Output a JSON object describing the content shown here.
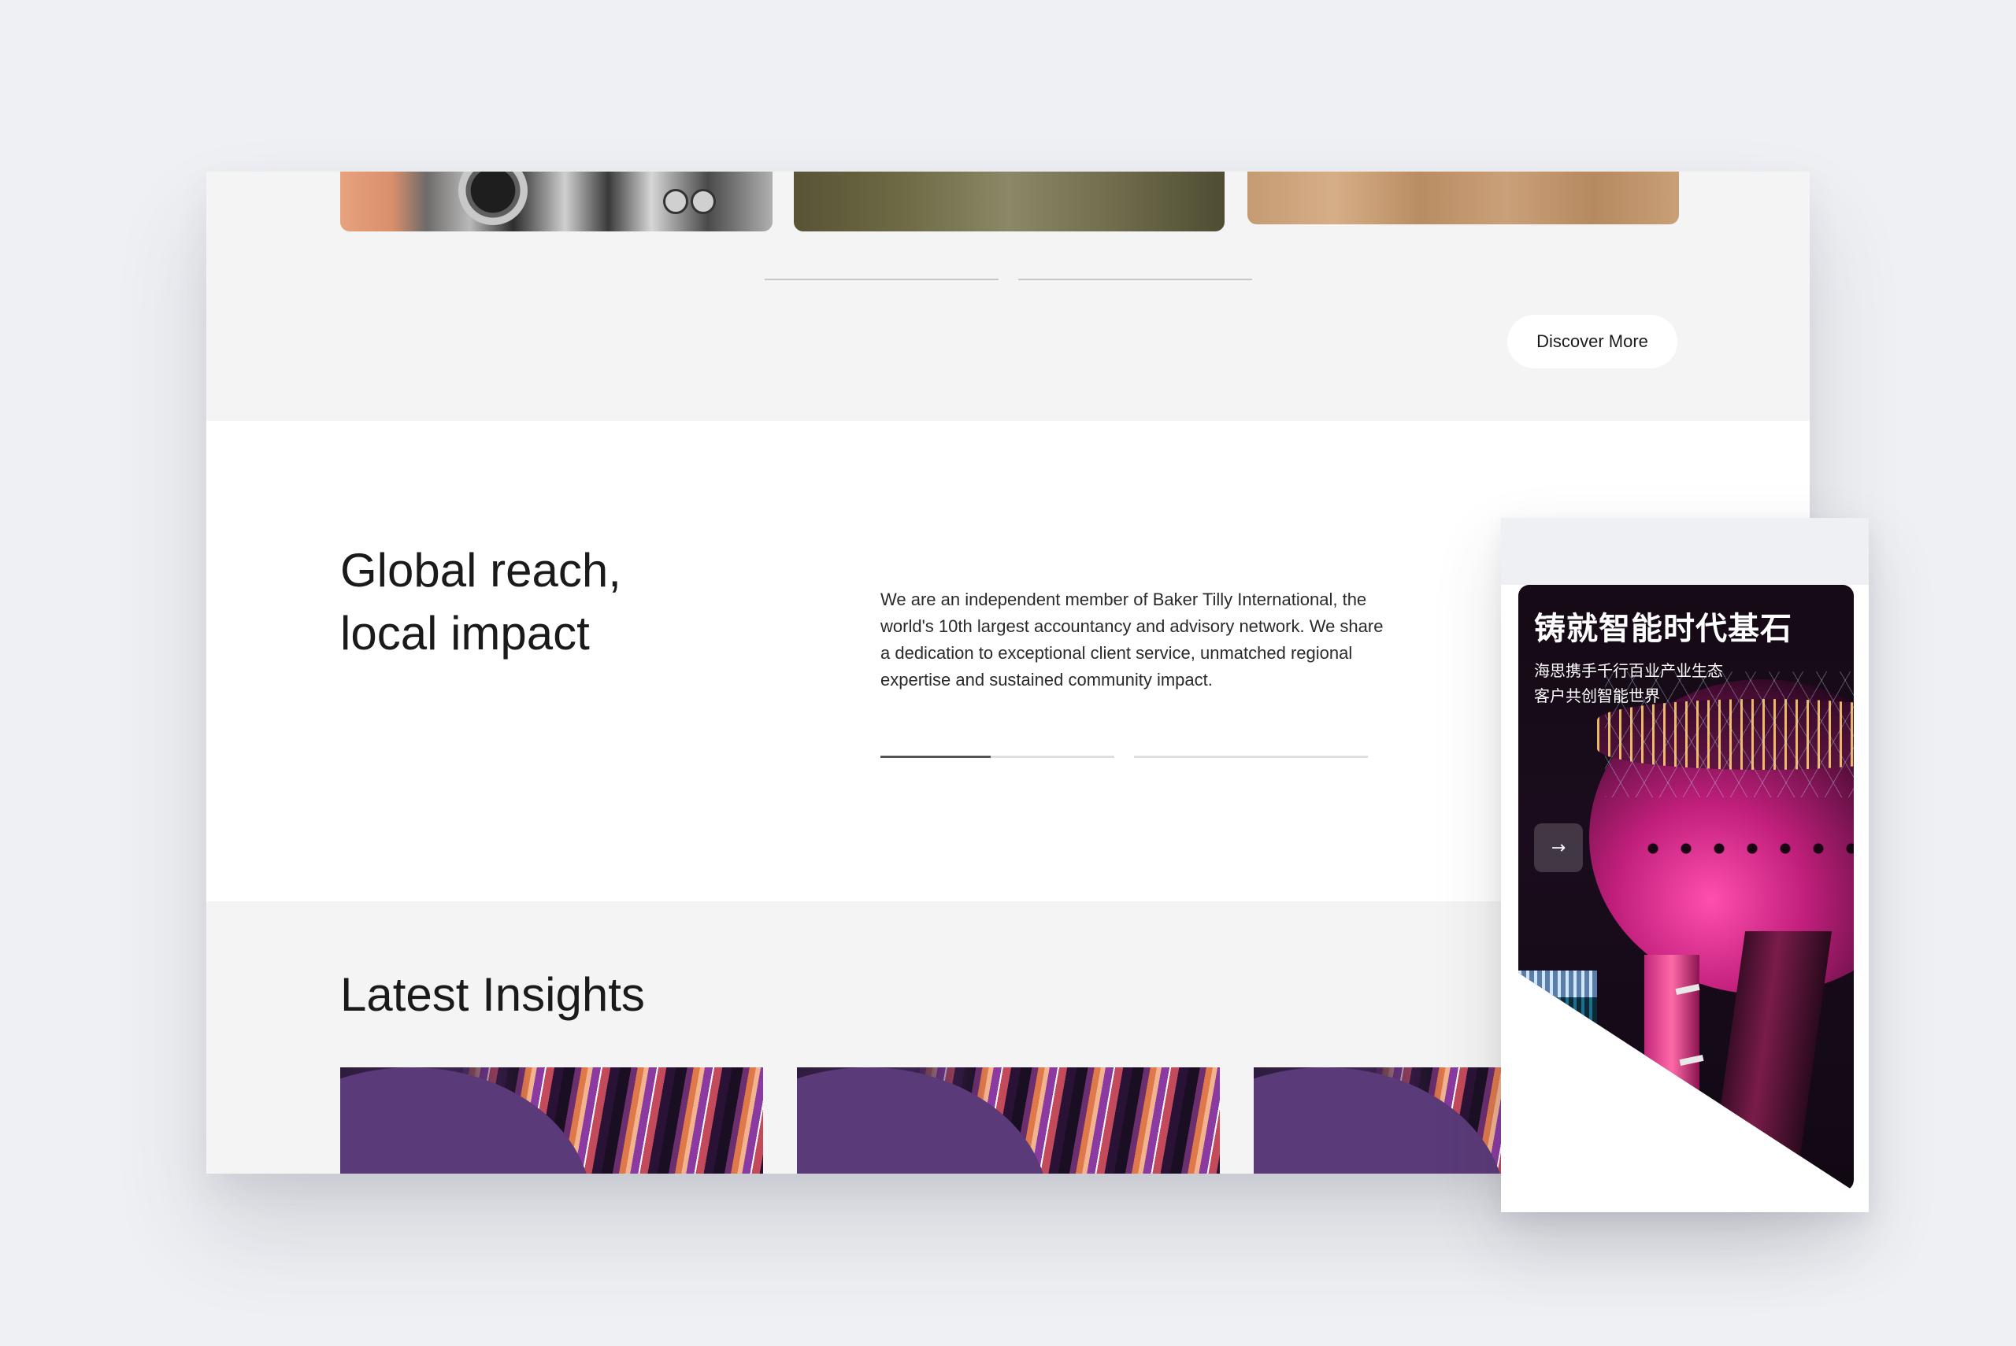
{
  "desktop": {
    "discover_button": "Discover More",
    "about": {
      "headline_line1": "Global reach,",
      "headline_line2": "local impact",
      "body": "We are an independent member of Baker Tilly International, the world's 10th largest accountancy and advisory network. We share a dedication to exceptional client service, unmatched regional expertise and sustained community impact.",
      "slider_progress": 0.47
    },
    "insights": {
      "title": "Latest Insights"
    }
  },
  "mobile": {
    "hero_title": "铸就智能时代基石",
    "hero_sub_line1": "海思携手千行百业产业生态",
    "hero_sub_line2": "客户共创智能世界",
    "arrow_icon": "arrow-right-icon",
    "arrow_glyph": "→"
  },
  "colors": {
    "page_bg": "#eff0f4",
    "section_gray": "#f4f4f4",
    "section_white": "#ffffff",
    "text": "#1a1a1a",
    "progress_fill": "#555555",
    "progress_track": "#dedede"
  }
}
